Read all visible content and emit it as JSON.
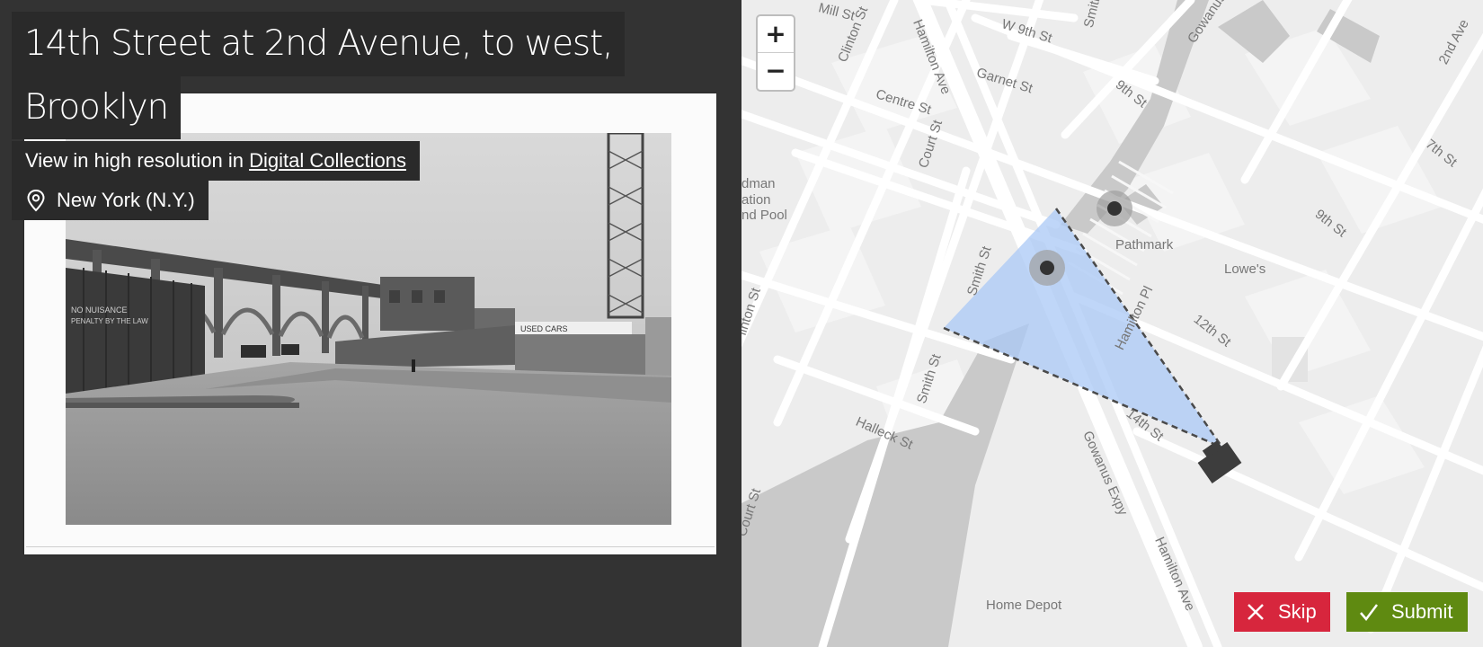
{
  "title": {
    "line1": "14th Street at 2nd Avenue, to west,",
    "line2": "Brooklyn"
  },
  "hires": {
    "prefix": "View in high resolution in ",
    "link_label": "Digital Collections"
  },
  "location": {
    "label": "New York (N.Y.)",
    "icon": "map-pin-icon"
  },
  "photo": {
    "signs": [
      "NO NUISANCE",
      "PENALTY BY THE LAW",
      "USED CARS"
    ]
  },
  "map": {
    "zoom_in_label": "+",
    "zoom_out_label": "−",
    "labels": {
      "mill_st": "Mill St",
      "clinton_st_top": "Clinton St",
      "hamilton_ave_top": "Hamilton Ave",
      "w9th_st": "W 9th St",
      "smith_st_top": "Smith St",
      "gowanus_top": "Gowanus",
      "second_ave": "2nd Ave",
      "garnet_st": "Garnet St",
      "ninth_st": "9th St",
      "centre_st": "Centre St",
      "seventh_st": "7th St",
      "court_st_top": "Court St",
      "poolname_1": "dman",
      "poolname_2": "ation",
      "poolname_3": "nd Pool",
      "ninth_st_right": "9th St",
      "pathmark": "Pathmark",
      "lowes": "Lowe's",
      "smith_st_mid": "Smith St",
      "clinton_st_left": "linton St",
      "twelfth_st": "12th St",
      "hamilton_pl": "Hamilton Pl",
      "smith_st_low": "Smith St",
      "halleck_st": "Halleck St",
      "fourteenth_st": "14th St",
      "gowanus_expy": "Gowanus Expy",
      "court_st_low": "Court St",
      "hamilton_ave_low": "Hamilton Ave",
      "home_depot": "Home Depot"
    }
  },
  "actions": {
    "skip_label": "Skip",
    "submit_label": "Submit"
  },
  "colors": {
    "panel_bg": "#333333",
    "skip": "#d7263d",
    "submit": "#5f8a11",
    "view_cone": "#a9c8f5"
  }
}
